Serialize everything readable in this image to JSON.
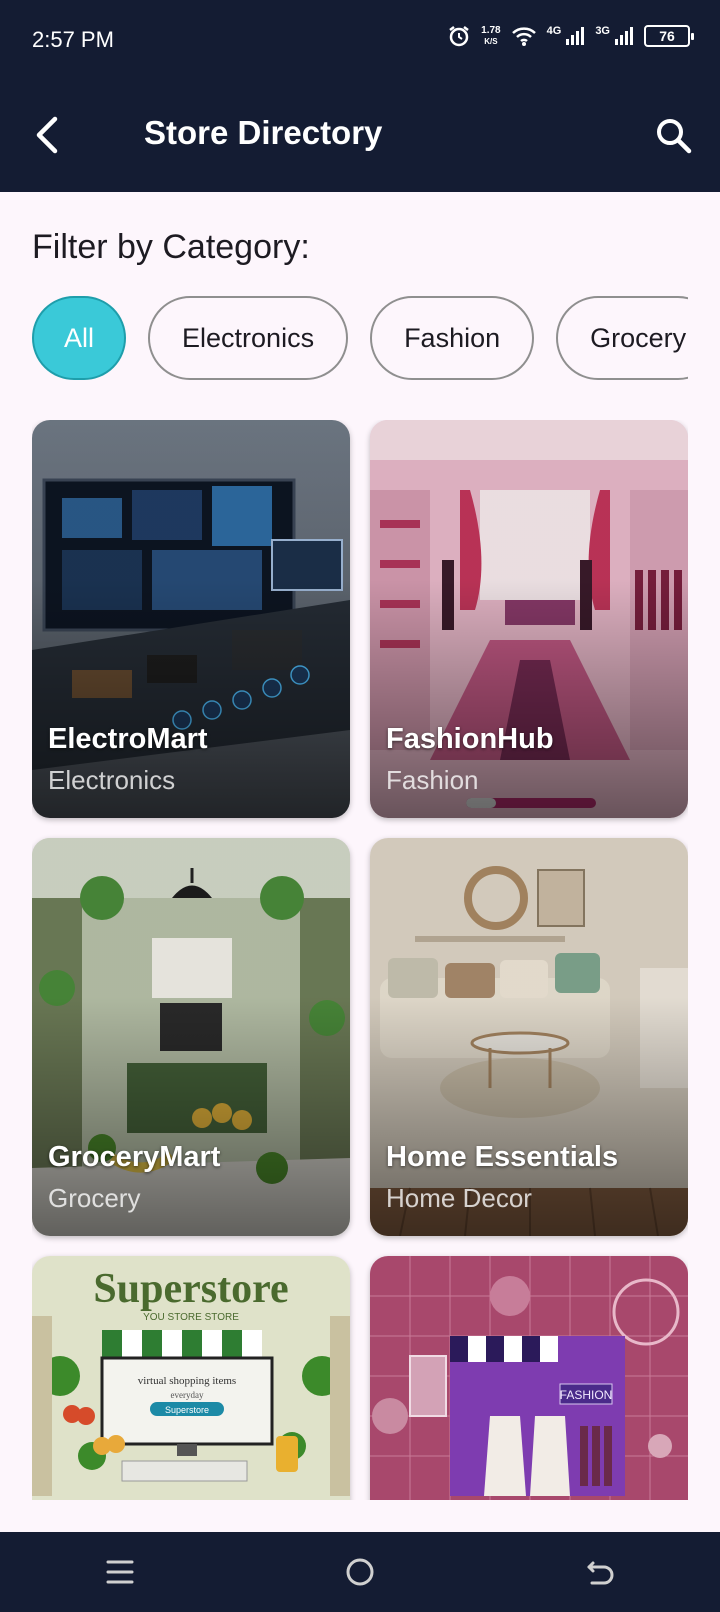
{
  "status_bar": {
    "time": "2:57 PM",
    "net_speed_value": "1.78",
    "net_speed_unit": "K/S",
    "signal_1": "4G",
    "signal_2": "3G",
    "battery": "76"
  },
  "app_bar": {
    "title": "Store Directory",
    "back_icon": "back-arrow-icon",
    "search_icon": "search-icon"
  },
  "filter": {
    "label": "Filter by Category:",
    "chips": [
      {
        "label": "All",
        "selected": true
      },
      {
        "label": "Electronics",
        "selected": false
      },
      {
        "label": "Fashion",
        "selected": false
      },
      {
        "label": "Grocery",
        "selected": false
      }
    ]
  },
  "stores": [
    {
      "name": "ElectroMart",
      "category": "Electronics"
    },
    {
      "name": "FashionHub",
      "category": "Fashion"
    },
    {
      "name": "GroceryMart",
      "category": "Grocery"
    },
    {
      "name": "Home Essentials",
      "category": "Home Decor"
    },
    {
      "name": "",
      "category": "",
      "art_text_title": "Superstore",
      "art_text_sub": "YOU STORE  STORE",
      "art_text_screen": "virtual shopping items",
      "art_text_screen2": "everyday",
      "art_text_button": "Superstore"
    },
    {
      "name": "",
      "category": "",
      "art_text_sign": "FASHION"
    }
  ],
  "colors": {
    "appbar_bg": "#141c33",
    "accent_chip": "#3ac9d8",
    "page_bg": "#fdf6fc"
  },
  "nav_bar": {
    "recents_icon": "menu-icon",
    "home_icon": "home-circle-icon",
    "back_icon": "back-return-icon"
  }
}
